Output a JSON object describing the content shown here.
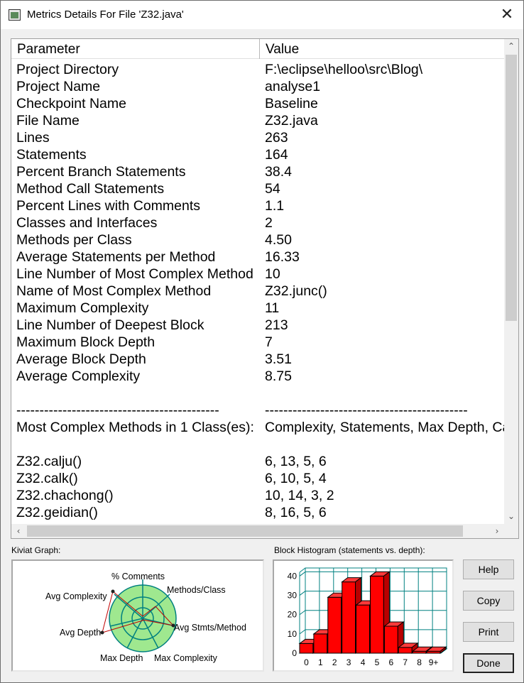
{
  "window": {
    "title": "Metrics Details For File 'Z32.java'",
    "close_glyph": "✕"
  },
  "table": {
    "headers": [
      "Parameter",
      "Value"
    ],
    "rows": [
      [
        "Project Directory",
        "F:\\eclipse\\helloo\\src\\Blog\\"
      ],
      [
        "Project Name",
        "analyse1"
      ],
      [
        "Checkpoint Name",
        "Baseline"
      ],
      [
        "File Name",
        "Z32.java"
      ],
      [
        "Lines",
        "263"
      ],
      [
        "Statements",
        "164"
      ],
      [
        "Percent Branch Statements",
        "38.4"
      ],
      [
        "Method Call Statements",
        "54"
      ],
      [
        "Percent Lines with Comments",
        "1.1"
      ],
      [
        "Classes and Interfaces",
        "2"
      ],
      [
        "Methods per Class",
        "4.50"
      ],
      [
        "Average Statements per Method",
        "16.33"
      ],
      [
        "Line Number of Most Complex Method",
        "10"
      ],
      [
        "Name of Most Complex Method",
        "Z32.junc()"
      ],
      [
        "Maximum Complexity",
        "11"
      ],
      [
        "Line Number of Deepest Block",
        "213"
      ],
      [
        "Maximum Block Depth",
        "7"
      ],
      [
        "Average Block Depth",
        "3.51"
      ],
      [
        "Average Complexity",
        "8.75"
      ],
      [
        "",
        ""
      ],
      [
        "--------------------------------------------",
        "--------------------------------------------"
      ],
      [
        "Most Complex Methods in 1 Class(es):",
        "Complexity, Statements, Max Depth, Calls"
      ],
      [
        "",
        ""
      ],
      [
        "Z32.calju()",
        "6, 13, 5, 6"
      ],
      [
        "Z32.calk()",
        "6, 10, 5, 4"
      ],
      [
        "Z32.chachong()",
        "10, 14, 3, 2"
      ],
      [
        "Z32.geidian()",
        "8, 16, 5, 6"
      ]
    ]
  },
  "kiviat": {
    "label": "Kiviat Graph:",
    "axes": [
      "% Comments",
      "Methods/Class",
      "Avg Stmts/Method",
      "Max Complexity",
      "Max Depth",
      "Avg Depth",
      "Avg Complexity"
    ]
  },
  "histogram": {
    "label": "Block Histogram (statements vs. depth):",
    "chart_data": {
      "type": "bar",
      "categories": [
        "0",
        "1",
        "2",
        "3",
        "4",
        "5",
        "6",
        "7",
        "8",
        "9+"
      ],
      "values": [
        5,
        10,
        29,
        37,
        25,
        40,
        14,
        3,
        1,
        1
      ],
      "y_ticks": [
        "0",
        "10",
        "20",
        "30",
        "40"
      ],
      "ylim": [
        0,
        42
      ],
      "bar_color": "#ff0000",
      "grid": true
    }
  },
  "buttons": {
    "help": "Help",
    "copy": "Copy",
    "print": "Print",
    "done": "Done"
  },
  "scroll": {
    "up": "⌃",
    "down": "⌄",
    "left": "‹",
    "right": "›"
  }
}
